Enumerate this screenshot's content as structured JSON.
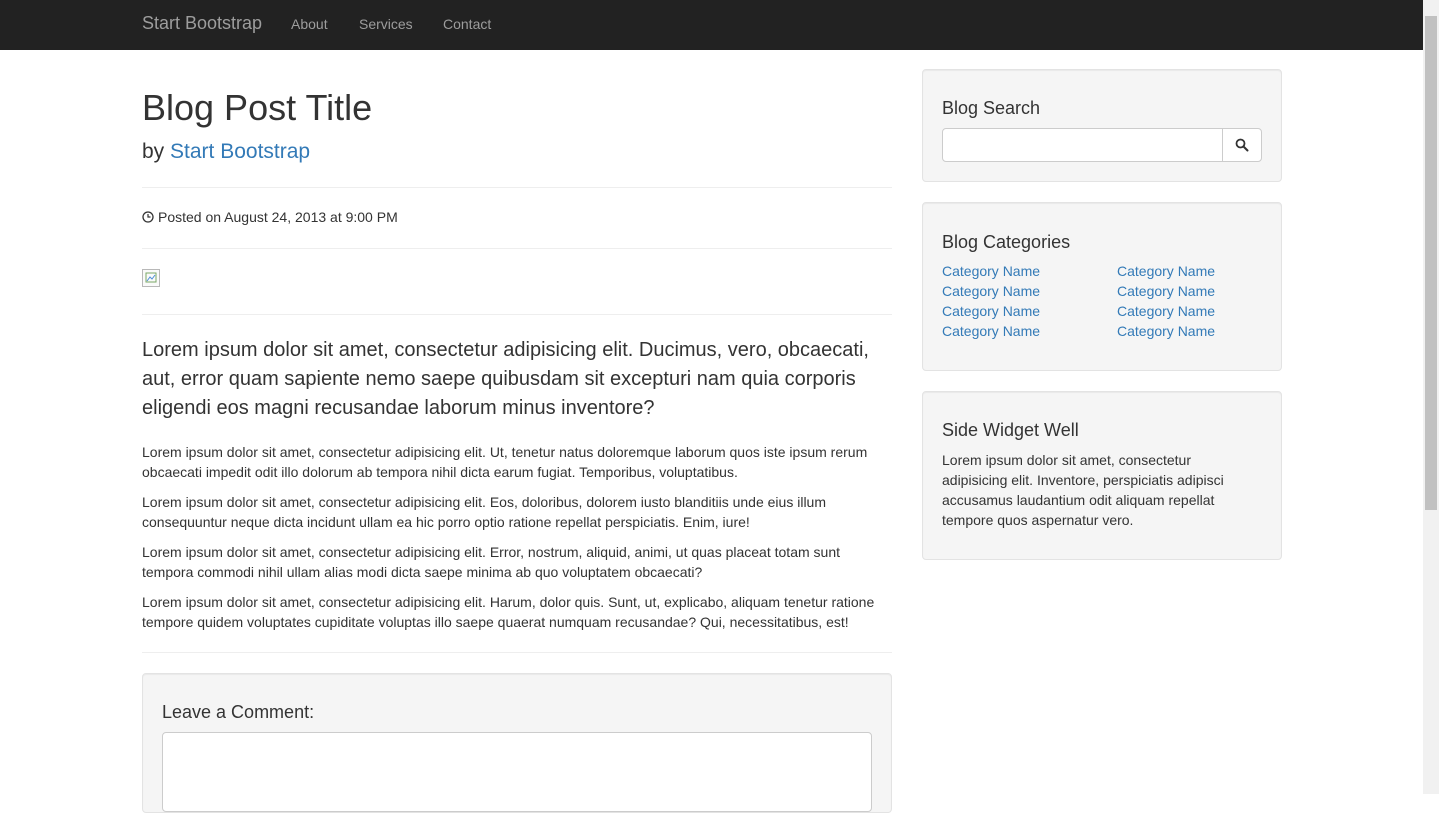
{
  "navbar": {
    "brand": "Start Bootstrap",
    "links": [
      "About",
      "Services",
      "Contact"
    ]
  },
  "post": {
    "title": "Blog Post Title",
    "by": "by",
    "author": "Start Bootstrap",
    "posted": "Posted on August 24, 2013 at 9:00 PM",
    "lead": "Lorem ipsum dolor sit amet, consectetur adipisicing elit. Ducimus, vero, obcaecati, aut, error quam sapiente nemo saepe quibusdam sit excepturi nam quia corporis eligendi eos magni recusandae laborum minus inventore?",
    "paragraphs": [
      "Lorem ipsum dolor sit amet, consectetur adipisicing elit. Ut, tenetur natus doloremque laborum quos iste ipsum rerum obcaecati impedit odit illo dolorum ab tempora nihil dicta earum fugiat. Temporibus, voluptatibus.",
      "Lorem ipsum dolor sit amet, consectetur adipisicing elit. Eos, doloribus, dolorem iusto blanditiis unde eius illum consequuntur neque dicta incidunt ullam ea hic porro optio ratione repellat perspiciatis. Enim, iure!",
      "Lorem ipsum dolor sit amet, consectetur adipisicing elit. Error, nostrum, aliquid, animi, ut quas placeat totam sunt tempora commodi nihil ullam alias modi dicta saepe minima ab quo voluptatem obcaecati?",
      "Lorem ipsum dolor sit amet, consectetur adipisicing elit. Harum, dolor quis. Sunt, ut, explicabo, aliquam tenetur ratione tempore quidem voluptates cupiditate voluptas illo saepe quaerat numquam recusandae? Qui, necessitatibus, est!"
    ]
  },
  "comment": {
    "heading": "Leave a Comment:",
    "value": ""
  },
  "sidebar": {
    "search": {
      "heading": "Blog Search",
      "value": "",
      "icon": "search-icon"
    },
    "categories": {
      "heading": "Blog Categories",
      "items": [
        "Category Name",
        "Category Name",
        "Category Name",
        "Category Name",
        "Category Name",
        "Category Name",
        "Category Name",
        "Category Name"
      ]
    },
    "widget": {
      "heading": "Side Widget Well",
      "text": "Lorem ipsum dolor sit amet, consectetur adipisicing elit. Inventore, perspiciatis adipisci accusamus laudantium odit aliquam repellat tempore quos aspernatur vero."
    }
  },
  "colors": {
    "navbar_bg": "#222222",
    "nav_text": "#9d9d9d",
    "link": "#337ab7",
    "well_bg": "#f5f5f5",
    "text": "#333333"
  }
}
